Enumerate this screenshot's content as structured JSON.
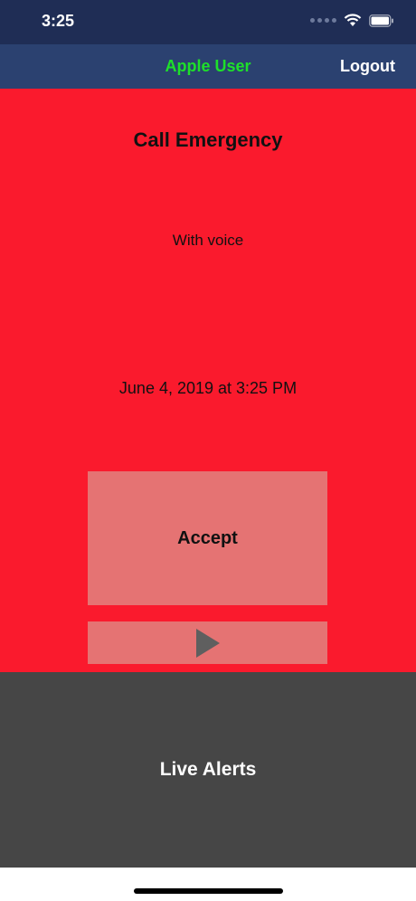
{
  "status_bar": {
    "time": "3:25",
    "icons": [
      "signal-icon",
      "wifi-icon",
      "battery-icon"
    ]
  },
  "nav": {
    "title": "Apple User",
    "logout_label": "Logout",
    "colors": {
      "background": "#2b4170",
      "title": "#1ee02a"
    }
  },
  "alert": {
    "title": "Call Emergency",
    "subtitle": "With voice",
    "timestamp": "June 4, 2019 at 3:25 PM",
    "accept_label": "Accept",
    "play_icon": "play-icon",
    "colors": {
      "background": "#fa1a2d",
      "button": "#e57373"
    }
  },
  "live_alerts": {
    "label": "Live Alerts",
    "colors": {
      "background": "#464646"
    }
  }
}
